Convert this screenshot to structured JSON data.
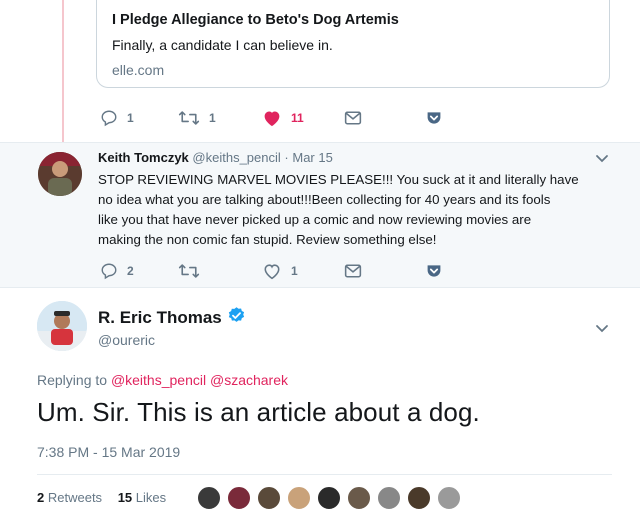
{
  "link_card": {
    "title": "I Pledge Allegiance to Beto's Dog Artemis",
    "description": "Finally, a candidate I can believe in.",
    "domain": "elle.com"
  },
  "first_actions": {
    "reply_count": "1",
    "retweet_count": "1",
    "like_count": "11"
  },
  "reply_tweet": {
    "name": "Keith Tomczyk",
    "handle": "@keiths_pencil",
    "sep": "·",
    "date": "Mar 15",
    "text_lines": [
      "STOP REVIEWING MARVEL MOVIES PLEASE!!! You suck at it and literally have",
      "no idea what you are talking about!!!Been collecting for 40 years and its fools",
      "like you that have never picked up a comic and now reviewing movies are",
      "making the non comic fan stupid. Review something else!"
    ],
    "reply_count": "2",
    "retweet_count": "",
    "like_count": "1"
  },
  "main_tweet": {
    "name": "R. Eric Thomas",
    "handle": "@oureric",
    "replying_prefix": "Replying to",
    "replying_user1": "@keiths_pencil",
    "replying_user2": "@szacharek",
    "text": "Um. Sir. This is an article about a dog.",
    "timestamp": "7:38 PM - 15 Mar 2019",
    "retweets_count": "2",
    "retweets_label": "Retweets",
    "likes_count": "15",
    "likes_label": "Likes"
  },
  "colors": {
    "accent": "#1da1f2",
    "like_red": "#e0245e",
    "muted": "#657786",
    "thread_line": "#f5c6cd",
    "reply_bg": "#f5f8fa"
  }
}
